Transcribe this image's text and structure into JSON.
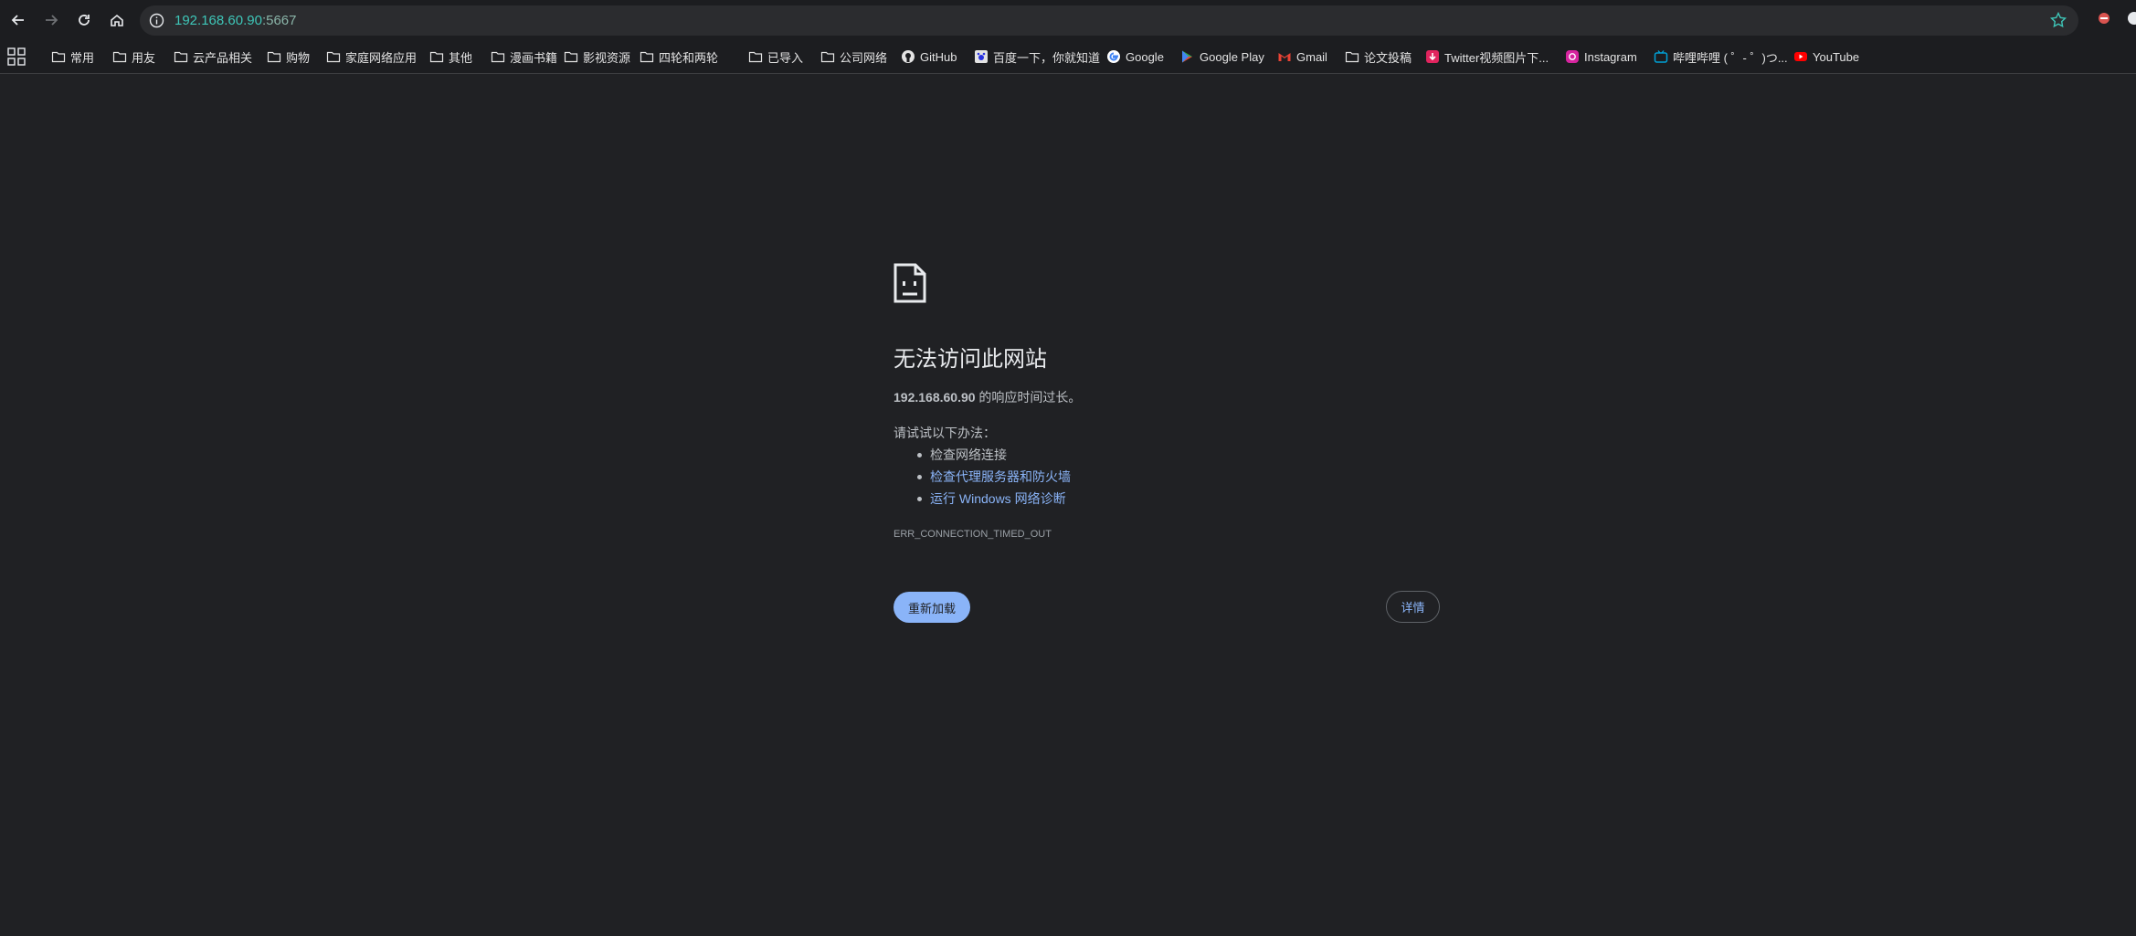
{
  "address_bar": {
    "host": "192.168.60.90",
    "port": ":5667"
  },
  "bookmarks": [
    {
      "label": "常用",
      "icon": "folder-icon"
    },
    {
      "label": "用友",
      "icon": "folder-icon"
    },
    {
      "label": "云产品相关",
      "icon": "folder-icon"
    },
    {
      "label": "购物",
      "icon": "folder-icon"
    },
    {
      "label": "家庭网络应用",
      "icon": "folder-icon"
    },
    {
      "label": "其他",
      "icon": "folder-icon"
    },
    {
      "label": "漫画书籍",
      "icon": "folder-icon"
    },
    {
      "label": "影视资源",
      "icon": "folder-icon"
    },
    {
      "label": "四轮和两轮",
      "icon": "folder-icon"
    },
    {
      "label": "已导入",
      "icon": "folder-icon"
    },
    {
      "label": "公司网络",
      "icon": "folder-icon"
    },
    {
      "label": "GitHub",
      "icon": "github-icon"
    },
    {
      "label": "百度一下，你就知道",
      "icon": "baidu-icon"
    },
    {
      "label": "Google",
      "icon": "google-icon"
    },
    {
      "label": "Google Play",
      "icon": "google-play-icon"
    },
    {
      "label": "Gmail",
      "icon": "gmail-icon"
    },
    {
      "label": "论文投稿",
      "icon": "folder-icon"
    },
    {
      "label": "Twitter视频图片下...",
      "icon": "twitter-downloader-icon"
    },
    {
      "label": "Instagram",
      "icon": "instagram-icon"
    },
    {
      "label": "哔哩哔哩 ( ゜- ゜)つ...",
      "icon": "bilibili-icon"
    },
    {
      "label": "YouTube",
      "icon": "youtube-icon"
    }
  ],
  "error": {
    "title": "无法访问此网站",
    "host": "192.168.60.90",
    "message_suffix": " 的响应时间过长。",
    "try_label": "请试试以下办法：",
    "suggestions": [
      "检查网络连接",
      "检查代理服务器和防火墙",
      "运行 Windows 网络诊断"
    ],
    "code": "ERR_CONNECTION_TIMED_OUT",
    "reload_label": "重新加载",
    "details_label": "详情"
  },
  "colors": {
    "page_background": "#202124",
    "link": "#8ab4f8",
    "url_host": "#3ec6b8",
    "primary_button": "#8ab4f8"
  }
}
